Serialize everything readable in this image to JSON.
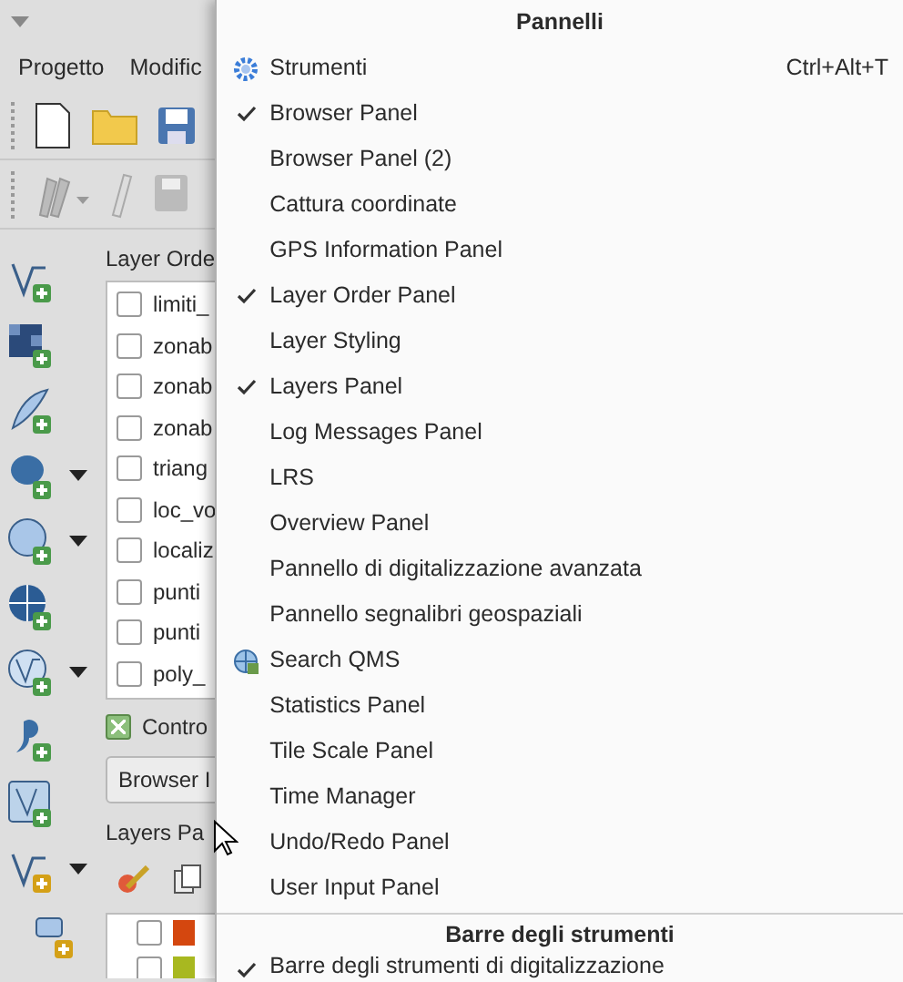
{
  "menubar": [
    "Progetto",
    "Modific"
  ],
  "layer_order_panel": {
    "title": "Layer Orde",
    "layers": [
      {
        "name": "limiti_",
        "checked": false
      },
      {
        "name": "zonab",
        "checked": false
      },
      {
        "name": "zonab",
        "checked": false
      },
      {
        "name": "zonab",
        "checked": false
      },
      {
        "name": "triang",
        "checked": false
      },
      {
        "name": "loc_vo",
        "checked": false
      },
      {
        "name": "localiz",
        "checked": false
      },
      {
        "name": "punti",
        "checked": false
      },
      {
        "name": "punti",
        "checked": false
      },
      {
        "name": "poly_",
        "checked": false
      }
    ]
  },
  "control_option": {
    "label": "Contro",
    "checked": true
  },
  "panel_select": {
    "value": "Browser I"
  },
  "layers_panel": {
    "title": "Layers Pa",
    "layers": [
      {
        "checked": false,
        "color": "#d4470f"
      },
      {
        "checked": false,
        "color": "#a8b820"
      }
    ]
  },
  "context_menu": {
    "sections": [
      {
        "title": "Pannelli",
        "items": [
          {
            "label": "Strumenti",
            "checked": false,
            "kind": "settings",
            "shortcut": "Ctrl+Alt+T"
          },
          {
            "label": "Browser Panel",
            "checked": true
          },
          {
            "label": "Browser Panel (2)",
            "checked": false
          },
          {
            "label": "Cattura coordinate",
            "checked": false
          },
          {
            "label": "GPS Information Panel",
            "checked": false
          },
          {
            "label": "Layer Order Panel",
            "checked": true
          },
          {
            "label": "Layer Styling",
            "checked": false
          },
          {
            "label": "Layers Panel",
            "checked": true
          },
          {
            "label": "Log Messages Panel",
            "checked": false
          },
          {
            "label": "LRS",
            "checked": false
          },
          {
            "label": "Overview Panel",
            "checked": false
          },
          {
            "label": "Pannello di digitalizzazione avanzata",
            "checked": false
          },
          {
            "label": "Pannello segnalibri geospaziali",
            "checked": false
          },
          {
            "label": "Search QMS",
            "checked": false,
            "kind": "web-search"
          },
          {
            "label": "Statistics Panel",
            "checked": false
          },
          {
            "label": "Tile Scale Panel",
            "checked": false
          },
          {
            "label": "Time Manager",
            "checked": false
          },
          {
            "label": "Undo/Redo Panel",
            "checked": false
          },
          {
            "label": "User Input Panel",
            "checked": false
          }
        ]
      },
      {
        "title": "Barre degli strumenti",
        "items": [
          {
            "label": "Barre degli strumenti di digitalizzazione",
            "checked": true
          }
        ]
      }
    ]
  }
}
